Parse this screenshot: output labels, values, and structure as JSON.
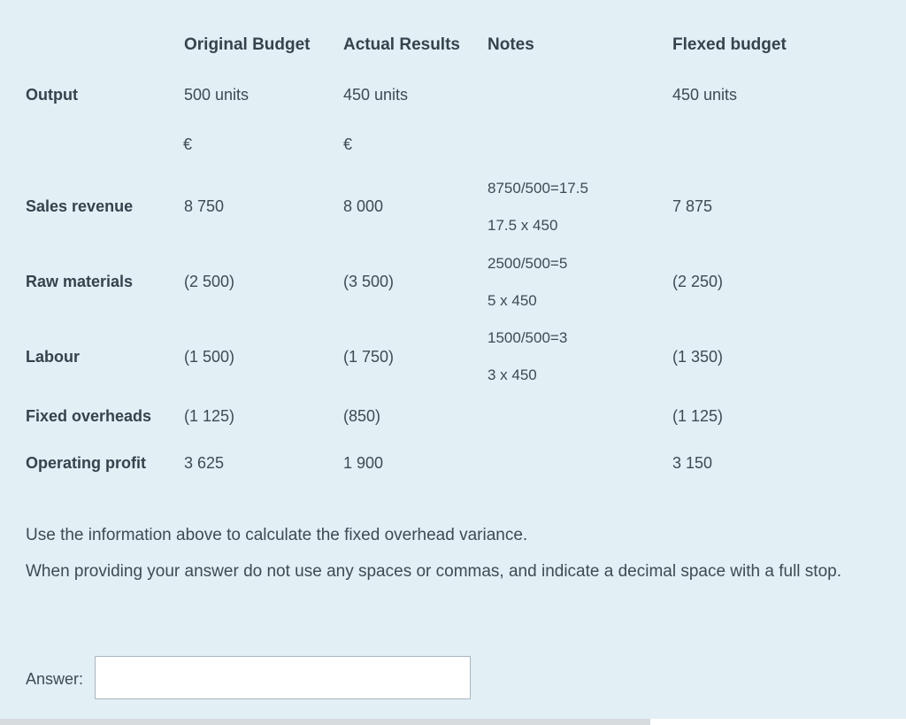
{
  "columns": {
    "original": "Original Budget",
    "actual": "Actual Results",
    "notes": "Notes",
    "flexed": "Flexed budget"
  },
  "rows": {
    "output": {
      "label": "Output",
      "original": "500 units",
      "actual": "450 units",
      "flexed": "450 units"
    },
    "currency": {
      "original": "€",
      "actual": "€"
    },
    "sales": {
      "label": "Sales revenue",
      "original": "8 750",
      "actual": "8 000",
      "note1": "8750/500=17.5",
      "note2": "17.5 x 450",
      "flexed": "7 875"
    },
    "raw": {
      "label": "Raw materials",
      "original": "(2 500)",
      "actual": "(3 500)",
      "note1": "2500/500=5",
      "note2": "5 x 450",
      "flexed": "(2 250)"
    },
    "labour": {
      "label": "Labour",
      "original": "(1 500)",
      "actual": "(1 750)",
      "note1": "1500/500=3",
      "note2": "3 x 450",
      "flexed": "(1 350)"
    },
    "fixed": {
      "label": "Fixed overheads",
      "original": "(1 125)",
      "actual": "(850)",
      "flexed": "(1 125)"
    },
    "profit": {
      "label": "Operating profit",
      "original": "3 625",
      "actual": "1 900",
      "flexed": "3 150"
    }
  },
  "instructions": {
    "line1": "Use the information above to calculate the fixed overhead variance.",
    "line2": "When providing your answer do not use any spaces or commas, and indicate a decimal space with a full stop."
  },
  "answer": {
    "label": "Answer:",
    "value": ""
  }
}
